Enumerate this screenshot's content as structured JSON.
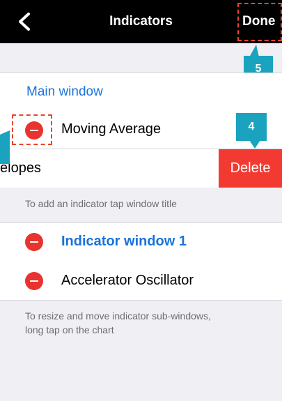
{
  "navbar": {
    "title": "Indicators",
    "done_label": "Done",
    "background": "#000000"
  },
  "callouts": {
    "badge_4": "4",
    "badge_5": "5",
    "color": "#1aa3bf",
    "outline_color": "#e8452e"
  },
  "main_section": {
    "header": "Main window",
    "items": [
      {
        "label": "Moving Average"
      },
      {
        "label": "elopes",
        "delete_label": "Delete"
      }
    ],
    "hint": "To add an indicator tap window title"
  },
  "indicator_section": {
    "header": "Indicator window 1",
    "items": [
      {
        "label": "Accelerator Oscillator"
      }
    ],
    "hint_line1": "To resize and move indicator sub-windows,",
    "hint_line2": "long tap on the chart"
  },
  "colors": {
    "accent_blue": "#1a73d9",
    "delete_red": "#f23a32",
    "background": "#efeff4"
  }
}
